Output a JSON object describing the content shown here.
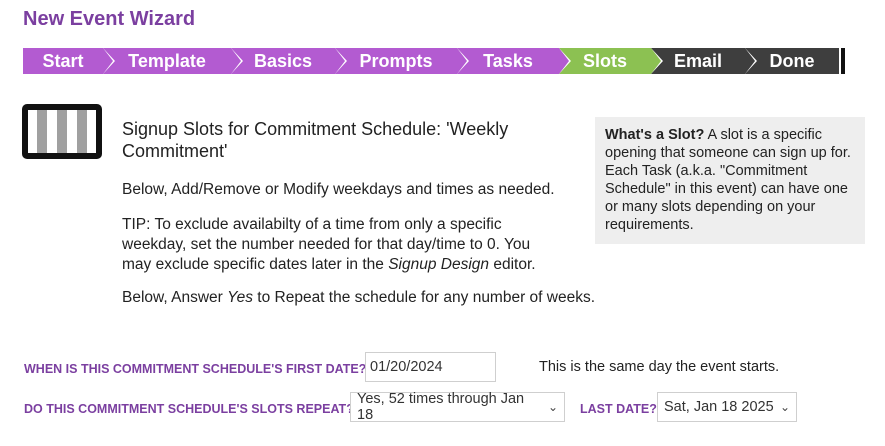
{
  "title": "New Event Wizard",
  "steps": [
    {
      "label": "Start",
      "state": "done"
    },
    {
      "label": "Template",
      "state": "done"
    },
    {
      "label": "Basics",
      "state": "done"
    },
    {
      "label": "Prompts",
      "state": "done"
    },
    {
      "label": "Tasks",
      "state": "done"
    },
    {
      "label": "Slots",
      "state": "current"
    },
    {
      "label": "Email",
      "state": "todo"
    },
    {
      "label": "Done",
      "state": "todo"
    }
  ],
  "colors": {
    "completed": "#b35bd1",
    "current": "#8cc152",
    "upcoming": "#3e3e3e",
    "accent": "#7b3fa0"
  },
  "icon": "schedule-icon",
  "heading": "Signup Slots for Commitment Schedule: 'Weekly Commitment'",
  "para1": "Below, Add/Remove or Modify weekdays and times as needed.",
  "tip": {
    "before": "TIP: To exclude availabilty of a time from only a specific weekday, set the number needed for that day/time to 0. You may exclude specific dates later in the ",
    "em": "Signup Design",
    "after": " editor."
  },
  "repeat_note": {
    "before": "Below, Answer ",
    "em": "Yes",
    "after": " to Repeat the schedule for any number of weeks."
  },
  "info": {
    "bold": "What's a Slot?",
    "text": " A slot is a specific opening that someone can sign up for. Each Task (a.k.a. \"Commitment Schedule\" in this event) can have one or many slots depending on your requirements."
  },
  "form": {
    "first_date_label": "WHEN IS THIS COMMITMENT SCHEDULE'S FIRST DATE?",
    "first_date_value": "01/20/2024",
    "first_date_note": "This is the same day the event starts.",
    "repeat_label": "DO THIS COMMITMENT SCHEDULE'S SLOTS REPEAT?",
    "repeat_value": "Yes, 52 times through Jan 18",
    "last_date_label": "LAST DATE?",
    "last_date_value": "Sat, Jan 18 2025"
  }
}
